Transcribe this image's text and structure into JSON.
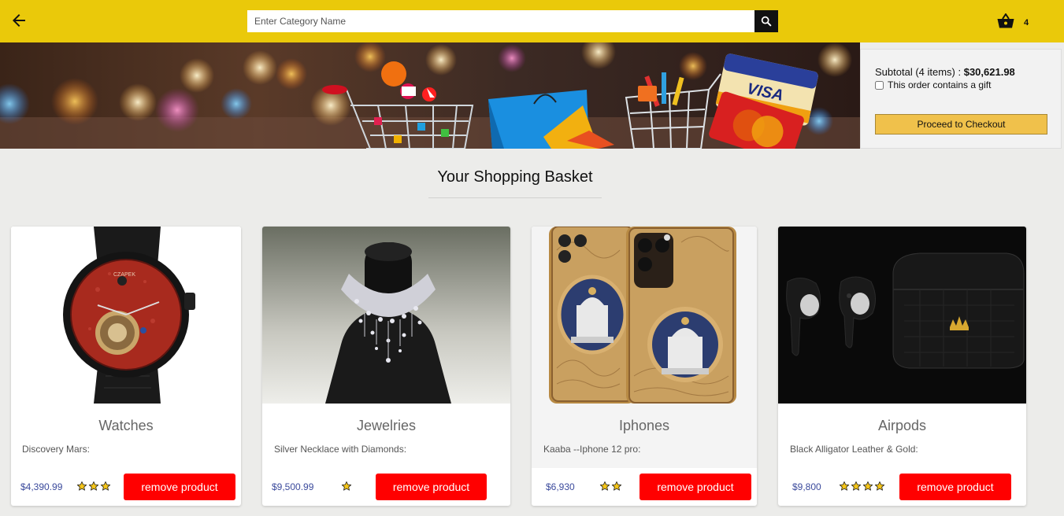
{
  "header": {
    "search_placeholder": "Enter Category Name",
    "basket_count": "4",
    "colors": {
      "background": "#eac90a",
      "search_button": "#111111"
    }
  },
  "subtotal": {
    "label": "Subtotal (4 items) : ",
    "amount": "$30,621.98",
    "gift_label": "This order contains a gift",
    "gift_checked": false,
    "checkout_label": "Proceed to Checkout"
  },
  "page": {
    "title": "Your Shopping Basket"
  },
  "products": [
    {
      "title": "Watches",
      "description": "Discovery Mars:",
      "price": "$4,390.99",
      "rating": 3,
      "remove_label": "remove product"
    },
    {
      "title": "Jewelries",
      "description": "Silver Necklace with Diamonds:",
      "price": "$9,500.99",
      "rating": 1,
      "remove_label": "remove product"
    },
    {
      "title": "Iphones",
      "description": "Kaaba --Iphone 12 pro:",
      "price": "$6,930",
      "rating": 2,
      "remove_label": "remove product"
    },
    {
      "title": "Airpods",
      "description": "Black Alligator Leather & Gold:",
      "price": "$9,800",
      "rating": 4,
      "remove_label": "remove product"
    }
  ],
  "icons": [
    "arrow-left-icon",
    "search-icon",
    "basket-icon",
    "star-icon"
  ],
  "theme": {
    "remove_button": "#ff0000",
    "price_color": "#3b4a9c",
    "checkout_button": "#f0c14b"
  }
}
